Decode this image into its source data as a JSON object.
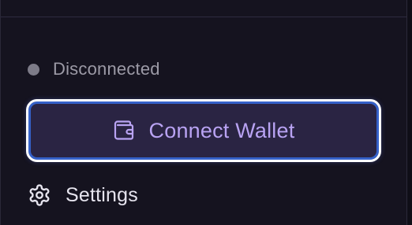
{
  "status": {
    "label": "Disconnected",
    "dot_color": "#7d7b88"
  },
  "connect": {
    "label": "Connect Wallet",
    "icon": "wallet-icon",
    "accent_color": "#b9a3f3",
    "focus_ring_color": "#3561c9"
  },
  "settings": {
    "label": "Settings",
    "icon": "gear-icon"
  }
}
